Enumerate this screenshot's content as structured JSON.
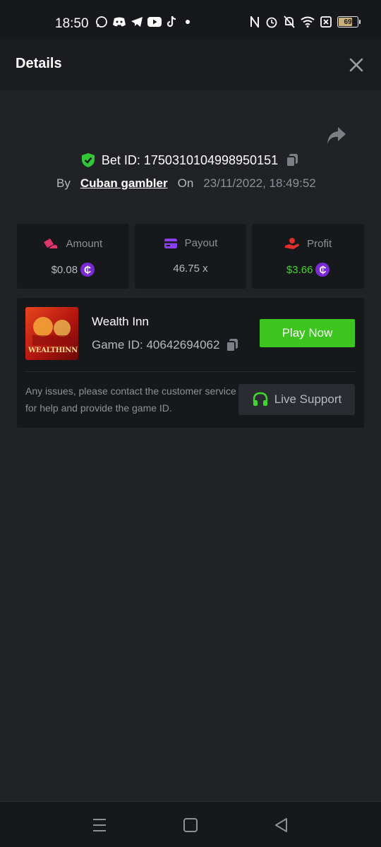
{
  "status_bar": {
    "time": "18:50",
    "battery_level": "69"
  },
  "header": {
    "title": "Details"
  },
  "bet": {
    "id_label": "Bet ID: 1750310104998950151",
    "by_label": "By",
    "username": "Cuban gambler",
    "on_label": "On",
    "datetime": "23/11/2022, 18:49:52"
  },
  "stats": [
    {
      "label": "Amount",
      "value": "$0.08",
      "icon": "amount-icon",
      "color": "#e0356a"
    },
    {
      "label": "Payout",
      "value": "46.75 x",
      "icon": "payout-icon",
      "color": "#8b3ff0"
    },
    {
      "label": "Profit",
      "value": "$3.66",
      "icon": "profit-icon",
      "color": "#e0302c"
    }
  ],
  "game": {
    "thumb_text": "WEALTHINN",
    "name": "Wealth Inn",
    "game_id_label": "Game ID: 40642694062",
    "play_label": "Play Now",
    "issue_text": "Any issues, please contact the customer service for help and provide the game ID.",
    "support_label": "Live Support"
  },
  "colors": {
    "accent_green": "#3cc41f",
    "coin_purple": "#7a2ad4",
    "profit_green": "#3fd52e",
    "shield_green": "#32c739"
  }
}
